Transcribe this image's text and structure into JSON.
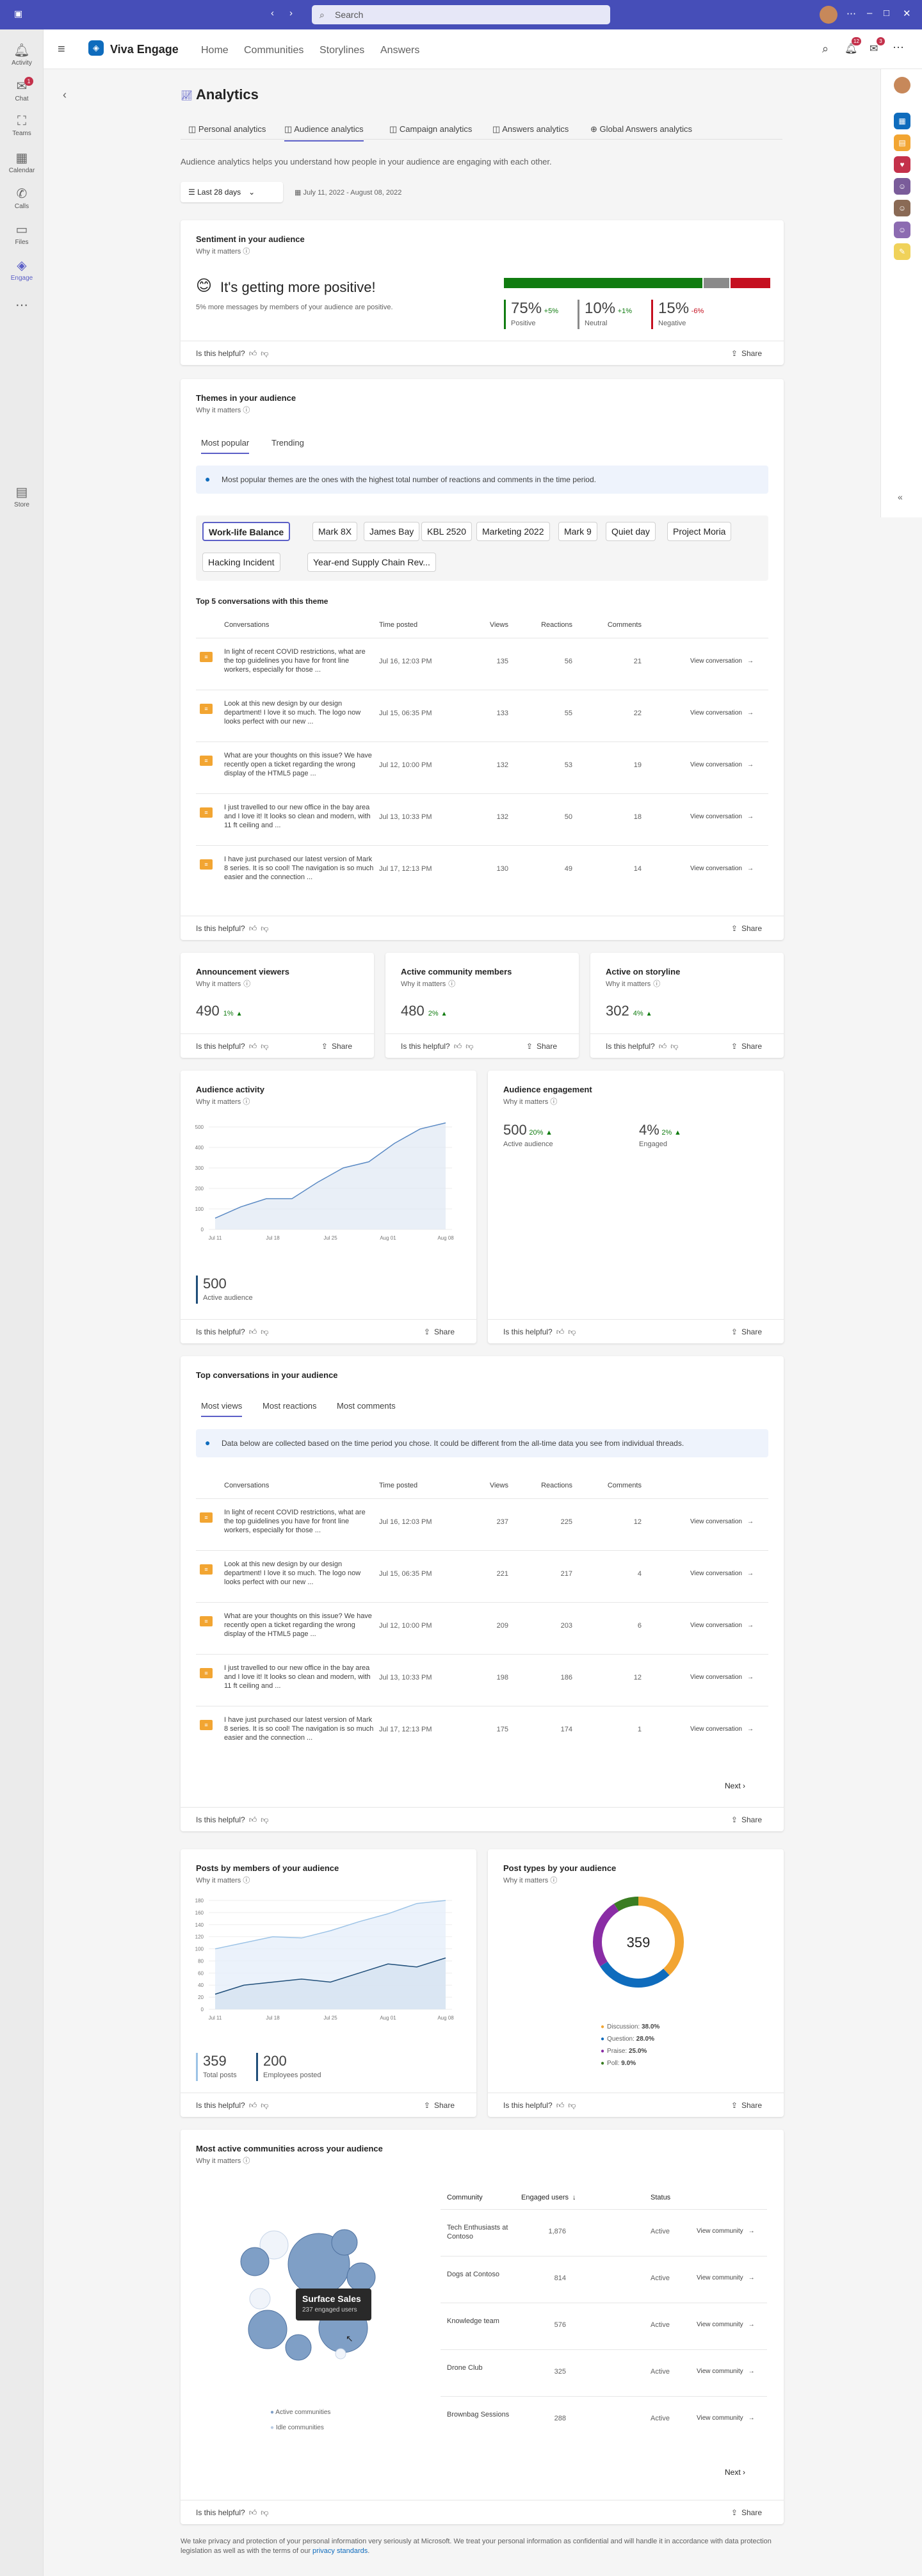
{
  "window": {
    "search_placeholder": "Search"
  },
  "rail": [
    {
      "label": "Activity",
      "icon": "bell-icon",
      "badge": ""
    },
    {
      "label": "Chat",
      "icon": "chat-icon",
      "badge": "1"
    },
    {
      "label": "Teams",
      "icon": "teams-icon",
      "badge": ""
    },
    {
      "label": "Calendar",
      "icon": "calendar-icon",
      "badge": ""
    },
    {
      "label": "Calls",
      "icon": "phone-icon",
      "badge": ""
    },
    {
      "label": "Files",
      "icon": "file-icon",
      "badge": ""
    },
    {
      "label": "Engage",
      "icon": "engage-icon",
      "badge": ""
    },
    {
      "label": "Store",
      "icon": "store-icon",
      "badge": ""
    }
  ],
  "app": {
    "name": "Viva Engage",
    "nav": [
      "Home",
      "Communities",
      "Storylines",
      "Answers"
    ],
    "notif_badge": "12",
    "inbox_badge": "3"
  },
  "page": {
    "title": "Analytics",
    "tabs": [
      "Personal analytics",
      "Audience analytics",
      "Campaign analytics",
      "Answers analytics",
      "Global Answers analytics"
    ],
    "description": "Audience analytics helps you understand how people in your audience are engaging with each other.",
    "date_filter": "Last 28 days",
    "date_range": "July 11, 2022 - August 08, 2022"
  },
  "common": {
    "why": "Why it matters",
    "helpful": "Is this helpful?",
    "share": "Share",
    "view_conv": "View conversation",
    "view_comm": "View community",
    "next": "Next"
  },
  "sentiment": {
    "title": "Sentiment in your audience",
    "headline": "It's getting more positive!",
    "sub": "5% more messages by members of your audience are positive.",
    "positive": "75%",
    "positive_d": "+5%",
    "positive_l": "Positive",
    "neutral": "10%",
    "neutral_d": "+1%",
    "neutral_l": "Neutral",
    "negative": "15%",
    "negative_d": "-6%",
    "negative_l": "Negative",
    "bar": {
      "positive": 0.75,
      "neutral": 0.1,
      "negative": 0.15
    }
  },
  "themes": {
    "title": "Themes in your audience",
    "tabs": [
      "Most popular",
      "Trending"
    ],
    "info": "Most popular themes are the ones with the highest total number of reactions and comments in the time period.",
    "pills": [
      "Work-life Balance",
      "Mark 8X",
      "James Bay",
      "KBL 2520",
      "Marketing 2022",
      "Mark 9",
      "Quiet day",
      "Project Moria",
      "Hacking Incident",
      "Year-end Supply Chain Rev..."
    ],
    "top_title": "Top 5 conversations with this theme",
    "cols": [
      "Conversations",
      "Time posted",
      "Views",
      "Reactions",
      "Comments"
    ],
    "rows": [
      [
        "In light of recent COVID restrictions, what are the top guidelines you have for front line workers, especially for those ...",
        "Jul 16, 12:03 PM",
        "135",
        "56",
        "21"
      ],
      [
        "Look at this new design by our design department! I love it so much. The logo now looks perfect with our new ...",
        "Jul 15, 06:35 PM",
        "133",
        "55",
        "22"
      ],
      [
        "What are your thoughts on this issue? We have recently open a ticket regarding the wrong display of the HTML5 page ...",
        "Jul 12, 10:00 PM",
        "132",
        "53",
        "19"
      ],
      [
        "I just travelled to our new office in the bay area and I love it! It looks so clean and modern, with 11 ft ceiling and ...",
        "Jul 13, 10:33 PM",
        "132",
        "50",
        "18"
      ],
      [
        "I have just purchased our latest version of Mark 8 series. It is so cool! The navigation is so much easier and the connection ...",
        "Jul 17, 12:13 PM",
        "130",
        "49",
        "14"
      ]
    ]
  },
  "metrics": [
    {
      "title": "Announcement viewers",
      "value": "490",
      "delta": "1%"
    },
    {
      "title": "Active community members",
      "value": "480",
      "delta": "2%"
    },
    {
      "title": "Active on storyline",
      "value": "302",
      "delta": "4%"
    }
  ],
  "activity": {
    "title": "Audience activity",
    "value": "500",
    "label": "Active audience"
  },
  "engagement": {
    "title": "Audience engagement",
    "v1": "500",
    "d1": "20%",
    "l1": "Active audience",
    "v2": "4%",
    "d2": "2%",
    "l2": "Engaged"
  },
  "top": {
    "title": "Top conversations in your audience",
    "tabs": [
      "Most views",
      "Most reactions",
      "Most comments"
    ],
    "info": "Data below are collected based on the time period you chose. It could be different from the all-time data you see from individual threads.",
    "cols": [
      "Conversations",
      "Time posted",
      "Views",
      "Reactions",
      "Comments"
    ],
    "rows": [
      [
        "In light of recent COVID restrictions, what are the top guidelines you have for front line workers, especially for those ...",
        "Jul 16, 12:03 PM",
        "237",
        "225",
        "12"
      ],
      [
        "Look at this new design by our design department! I love it so much. The logo now looks perfect with our new ...",
        "Jul 15, 06:35 PM",
        "221",
        "217",
        "4"
      ],
      [
        "What are your thoughts on this issue? We have recently open a ticket regarding the wrong display of the HTML5 page ...",
        "Jul 12, 10:00 PM",
        "209",
        "203",
        "6"
      ],
      [
        "I just travelled to our new office in the bay area and I love it! It looks so clean and modern, with 11 ft ceiling and ...",
        "Jul 13, 10:33 PM",
        "198",
        "186",
        "12"
      ],
      [
        "I have just purchased our latest version of Mark 8 series. It is so cool! The navigation is so much easier and the connection ...",
        "Jul 17, 12:13 PM",
        "175",
        "174",
        "1"
      ]
    ]
  },
  "posts": {
    "title": "Posts by members of your audience",
    "v1": "359",
    "l1": "Total posts",
    "v2": "200",
    "l2": "Employees posted"
  },
  "types": {
    "title": "Post types by your audience",
    "center": "359",
    "legend": [
      {
        "name": "Discussion",
        "pct": "38.0%",
        "color": "#f2a532"
      },
      {
        "name": "Question",
        "pct": "28.0%",
        "color": "#0f6cbd"
      },
      {
        "name": "Praise",
        "pct": "25.0%",
        "color": "#8a2da5"
      },
      {
        "name": "Poll",
        "pct": "9.0%",
        "color": "#3a7d22"
      }
    ]
  },
  "communities": {
    "title": "Most active communities across your audience",
    "tooltip_title": "Surface Sales",
    "tooltip_sub": "237 engaged users",
    "legend_active": "Active communities",
    "legend_idle": "Idle communities",
    "cols": [
      "Community",
      "Engaged users",
      "Status"
    ],
    "rows": [
      [
        "Tech Enthusiasts at Contoso",
        "1,876",
        "Active"
      ],
      [
        "Dogs at Contoso",
        "814",
        "Active"
      ],
      [
        "Knowledge team",
        "576",
        "Active"
      ],
      [
        "Drone Club",
        "325",
        "Active"
      ],
      [
        "Brownbag Sessions",
        "288",
        "Active"
      ]
    ]
  },
  "footer": {
    "privacy": "We take privacy and protection of your personal information very seriously at Microsoft. We treat your personal information as confidential and will handle it in accordance with data protection legislation as well as with the terms of our",
    "link": "privacy standards"
  },
  "chart_data": [
    {
      "type": "line",
      "title": "Audience activity",
      "x": [
        "Jul 11",
        "Jul 18",
        "Jul 25",
        "Aug 01",
        "Aug 08"
      ],
      "ylim": [
        0,
        500
      ],
      "yticks": [
        0,
        100,
        200,
        300,
        400,
        500
      ],
      "series": [
        {
          "values": [
            55,
            110,
            150,
            150,
            230,
            300,
            330,
            420,
            490,
            520
          ]
        }
      ]
    },
    {
      "type": "area",
      "title": "Posts by members of your audience",
      "x": [
        "Jul 11",
        "Jul 18",
        "Jul 25",
        "Aug 01",
        "Aug 08"
      ],
      "ylim": [
        0,
        180
      ],
      "yticks": [
        0,
        20,
        40,
        60,
        80,
        100,
        120,
        140,
        160,
        180
      ],
      "series": [
        {
          "values": [
            100,
            110,
            120,
            118,
            130,
            145,
            158,
            175,
            180
          ]
        },
        {
          "values": [
            25,
            40,
            45,
            50,
            45,
            60,
            75,
            70,
            85
          ]
        }
      ]
    },
    {
      "type": "pie",
      "title": "Post types by your audience",
      "categories": [
        "Discussion",
        "Question",
        "Praise",
        "Poll"
      ],
      "values": [
        38.0,
        28.0,
        25.0,
        9.0
      ]
    }
  ]
}
